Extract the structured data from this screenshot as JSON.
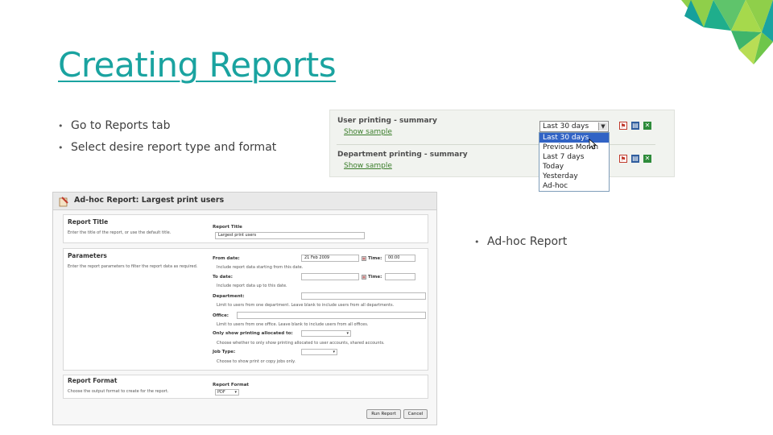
{
  "slide": {
    "title": "Creating Reports",
    "bullets": [
      "Go to Reports tab",
      "Select desire report type and format"
    ],
    "side_bullet": "Ad-hoc Report",
    "accent_color": "#1aa3a0"
  },
  "reports_summary": {
    "rows": [
      {
        "title": "User printing - summary",
        "sample_label": "Show sample",
        "range": "Last 30 days"
      },
      {
        "title": "Department printing - summary",
        "sample_label": "Show sample",
        "range": ""
      }
    ],
    "format_icons": [
      "pdf-icon",
      "html-icon",
      "excel-icon"
    ],
    "dropdown_options": [
      "Last 30 days",
      "Previous Month",
      "Last 7 days",
      "Today",
      "Yesterday",
      "Ad-hoc"
    ],
    "dropdown_selected": "Last 30 days"
  },
  "adhoc_form": {
    "header": "Ad-hoc Report: Largest print users",
    "report_title": {
      "section": "Report Title",
      "section_desc": "Enter the title of the report, or use the default title.",
      "field_label": "Report Title",
      "field_value": "Largest print users"
    },
    "parameters": {
      "section": "Parameters",
      "section_desc": "Enter the report parameters to filter the report data as required.",
      "from_date_label": "From date:",
      "from_date_value": "21 Feb 2009",
      "time_label": "Time:",
      "from_time_value": "00:00",
      "from_help": "Include report data starting from this date.",
      "to_date_label": "To date:",
      "to_help": "Include report data up to this date.",
      "department_label": "Department:",
      "department_help": "Limit to users from one department. Leave blank to include users from all departments.",
      "office_label": "Office:",
      "office_help": "Limit to users from one office. Leave blank to include users from all offices.",
      "allocated_label": "Only show printing allocated to:",
      "allocated_help": "Choose whether to only show printing allocated to user accounts, shared accounts.",
      "job_type_label": "Job Type:",
      "job_type_help": "Choose to show print or copy jobs only."
    },
    "report_format": {
      "section": "Report Format",
      "section_desc": "Choose the output format to create for the report.",
      "field_label": "Report Format",
      "field_value": "PDF"
    },
    "buttons": {
      "run": "Run Report",
      "cancel": "Cancel"
    }
  }
}
